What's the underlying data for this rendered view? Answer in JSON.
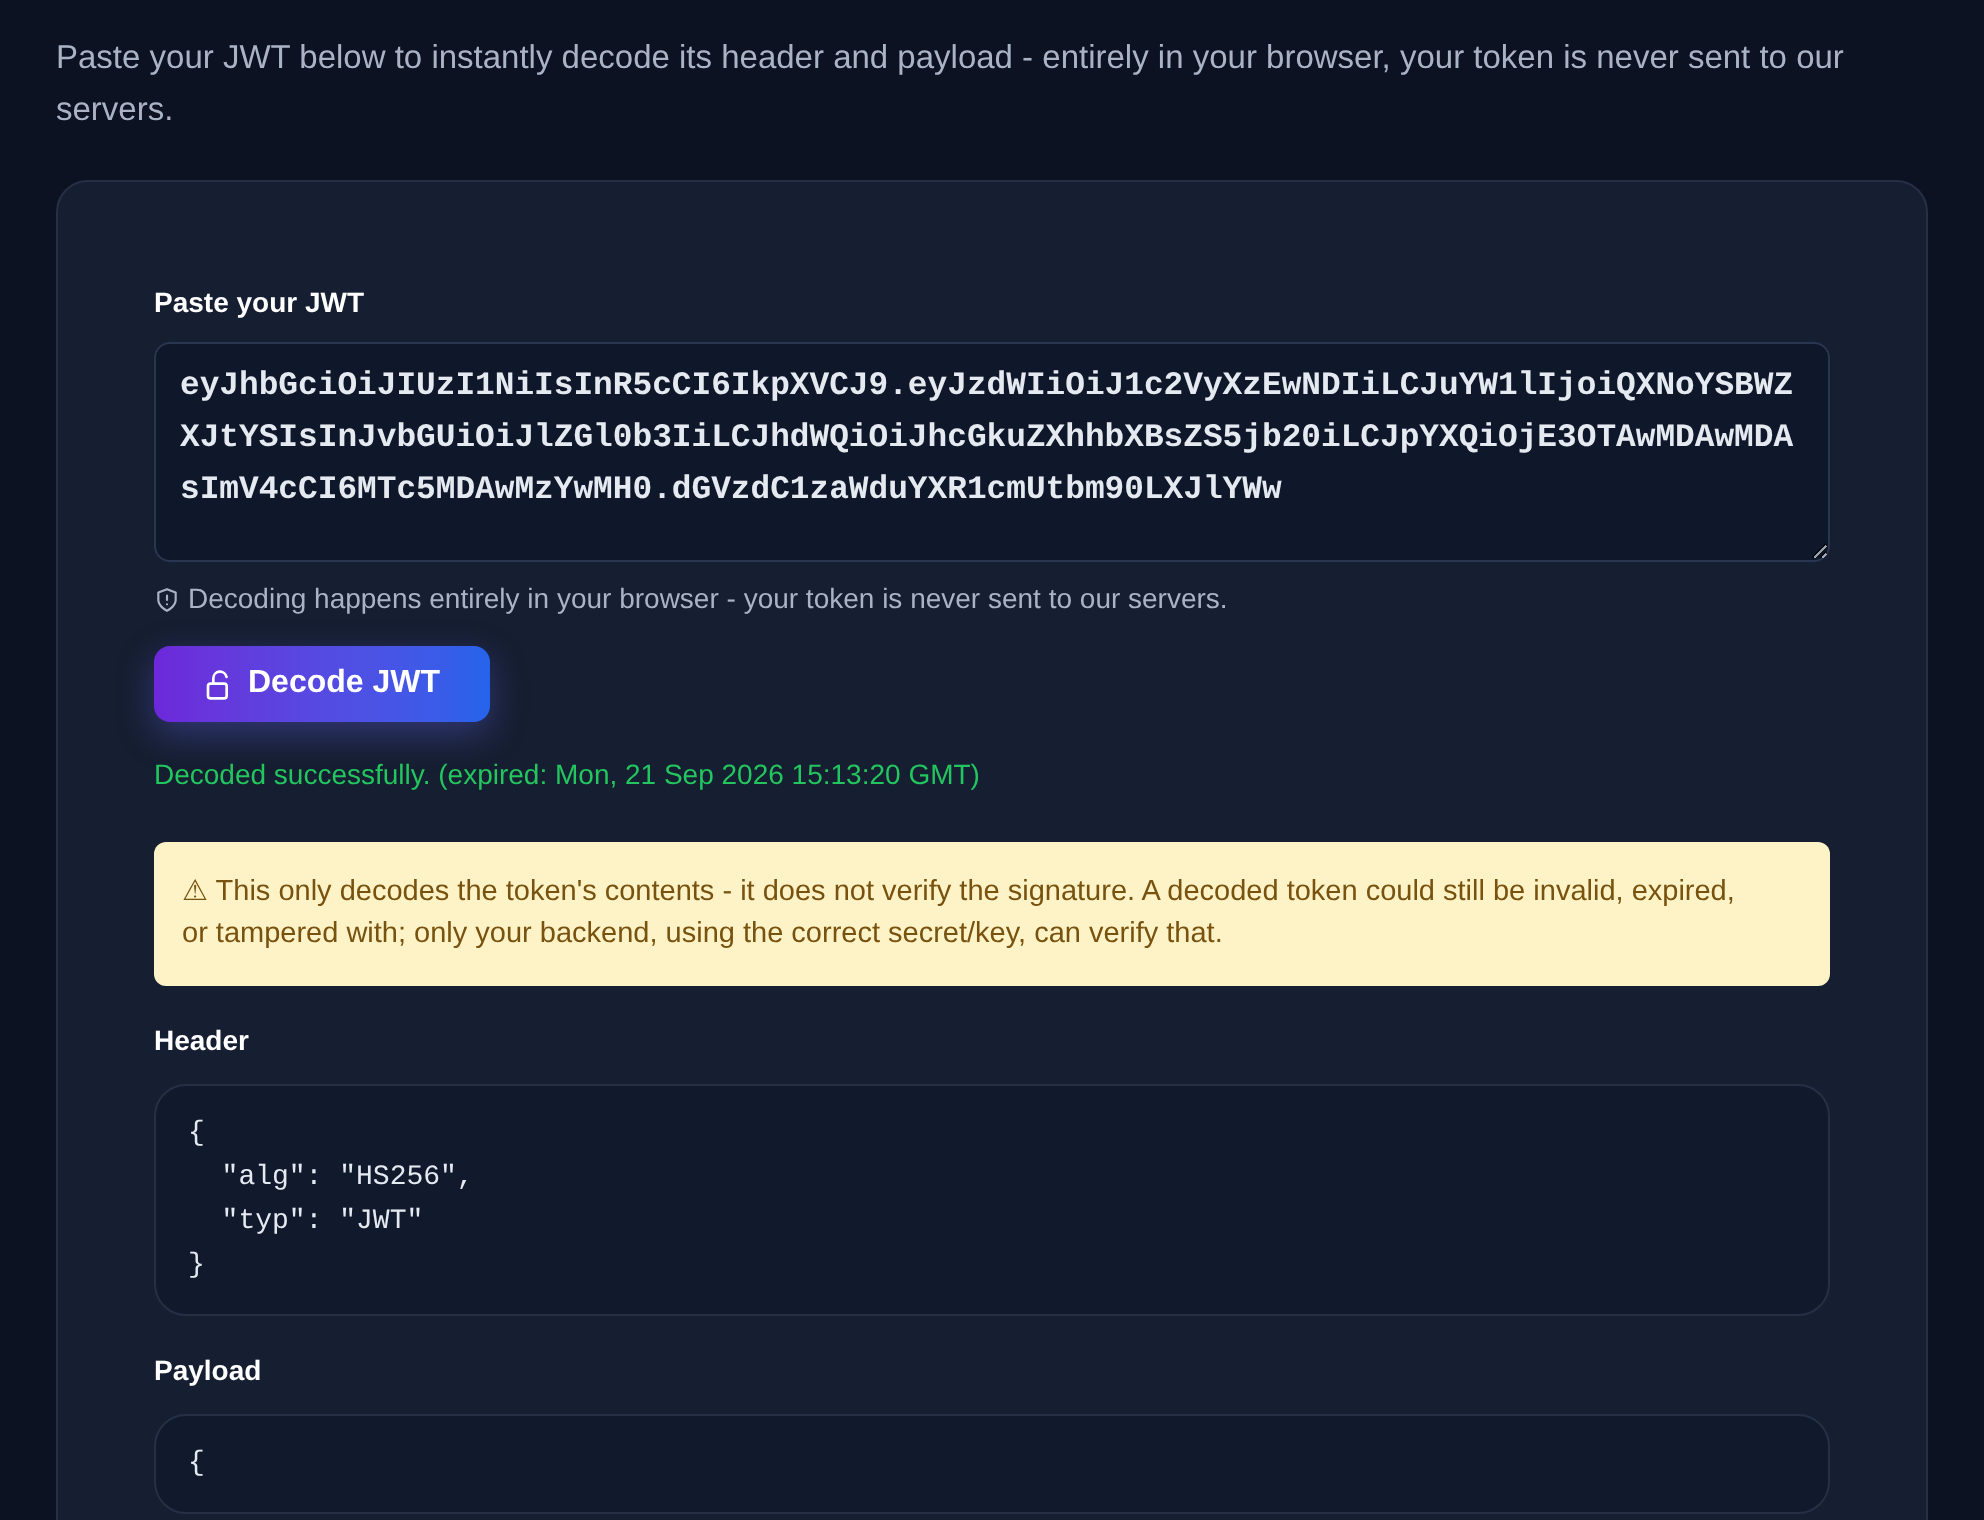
{
  "intro": "Paste your JWT below to instantly decode its header and payload - entirely in your browser, your token is never sent to our servers.",
  "token_field": {
    "label": "Paste your JWT",
    "value": "eyJhbGciOiJIUzI1NiIsInR5cCI6IkpXVCJ9.eyJzdWIiOiJ1c2VyXzEwNDIiLCJuYW1lIjoiQXNoYSBWZXJtYSIsInJvbGUiOiJlZGl0b3IiLCJhdWQiOiJhcGkuZXhhbXBsZS5jb20iLCJpYXQiOjE3OTAwMDAwMDAsImV4cCI6MTc5MDAwMzYwMH0.dGVzdC1zaWduYXR1cmUtbm90LXJlYWw"
  },
  "privacy_note": "Decoding happens entirely in your browser - your token is never sent to our servers.",
  "decode_button": "Decode JWT",
  "status": {
    "kind": "success",
    "text": "Decoded successfully. (expired: Mon, 21 Sep 2026 15:13:20 GMT)"
  },
  "warning": "⚠ This only decodes the token's contents - it does not verify the signature. A decoded token could still be invalid, expired, or tampered with; only your backend, using the correct secret/key, can verify that.",
  "sections": [
    {
      "title": "Header",
      "lines": [
        "{",
        "  \"alg\": \"HS256\",",
        "  \"typ\": \"JWT\"",
        "}"
      ]
    },
    {
      "title": "Payload",
      "lines": [
        "{"
      ]
    }
  ]
}
